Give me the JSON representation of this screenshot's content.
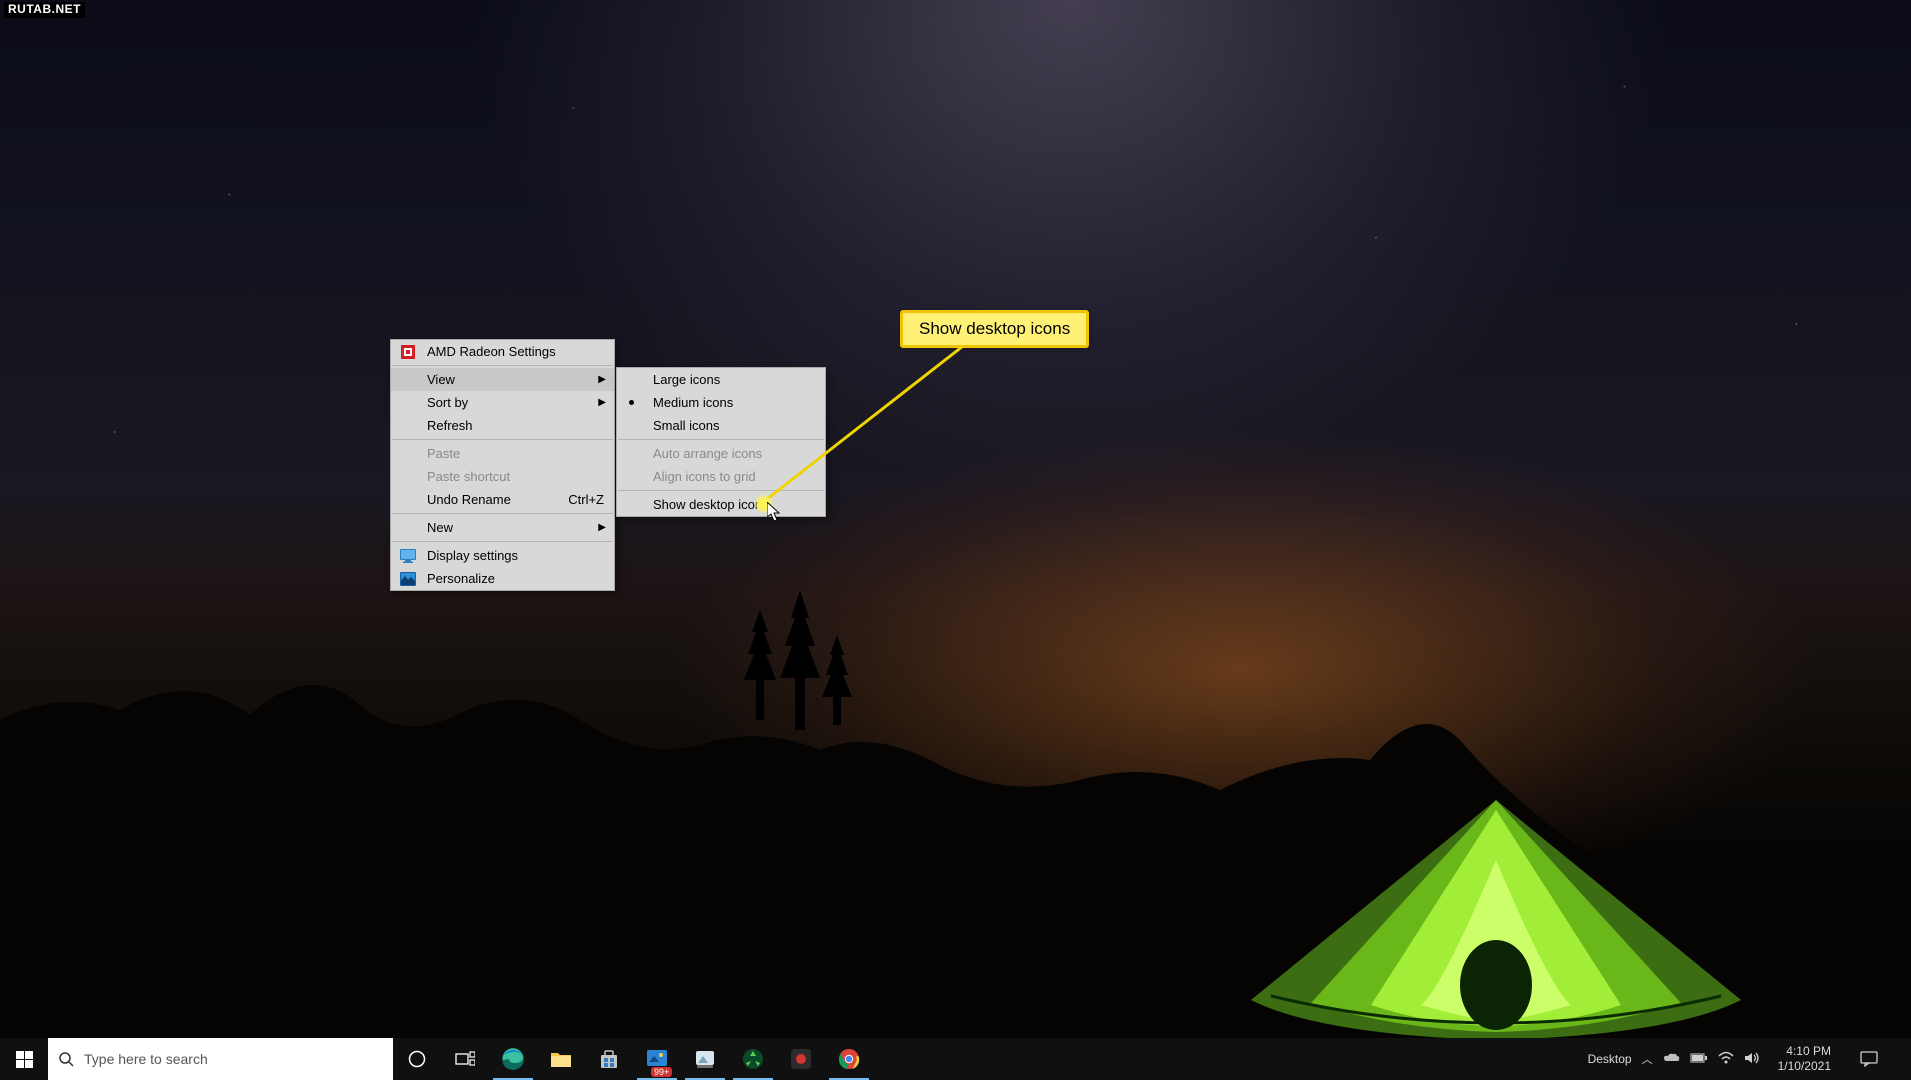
{
  "watermark": "RUTAB.NET",
  "callout_text": "Show desktop icons",
  "context_menu": {
    "amd": "AMD Radeon Settings",
    "view": "View",
    "sort": "Sort by",
    "refresh": "Refresh",
    "paste": "Paste",
    "paste_shortcut": "Paste shortcut",
    "undo_rename": "Undo Rename",
    "undo_shortcut": "Ctrl+Z",
    "new": "New",
    "display_settings": "Display settings",
    "personalize": "Personalize"
  },
  "submenu": {
    "large": "Large icons",
    "medium": "Medium icons",
    "small": "Small icons",
    "auto_arrange": "Auto arrange icons",
    "align_grid": "Align icons to grid",
    "show_desktop": "Show desktop icons"
  },
  "taskbar": {
    "search_placeholder": "Type here to search",
    "desktop_label": "Desktop",
    "tray_badge": "99+",
    "time": "4:10 PM",
    "date": "1/10/2021"
  }
}
